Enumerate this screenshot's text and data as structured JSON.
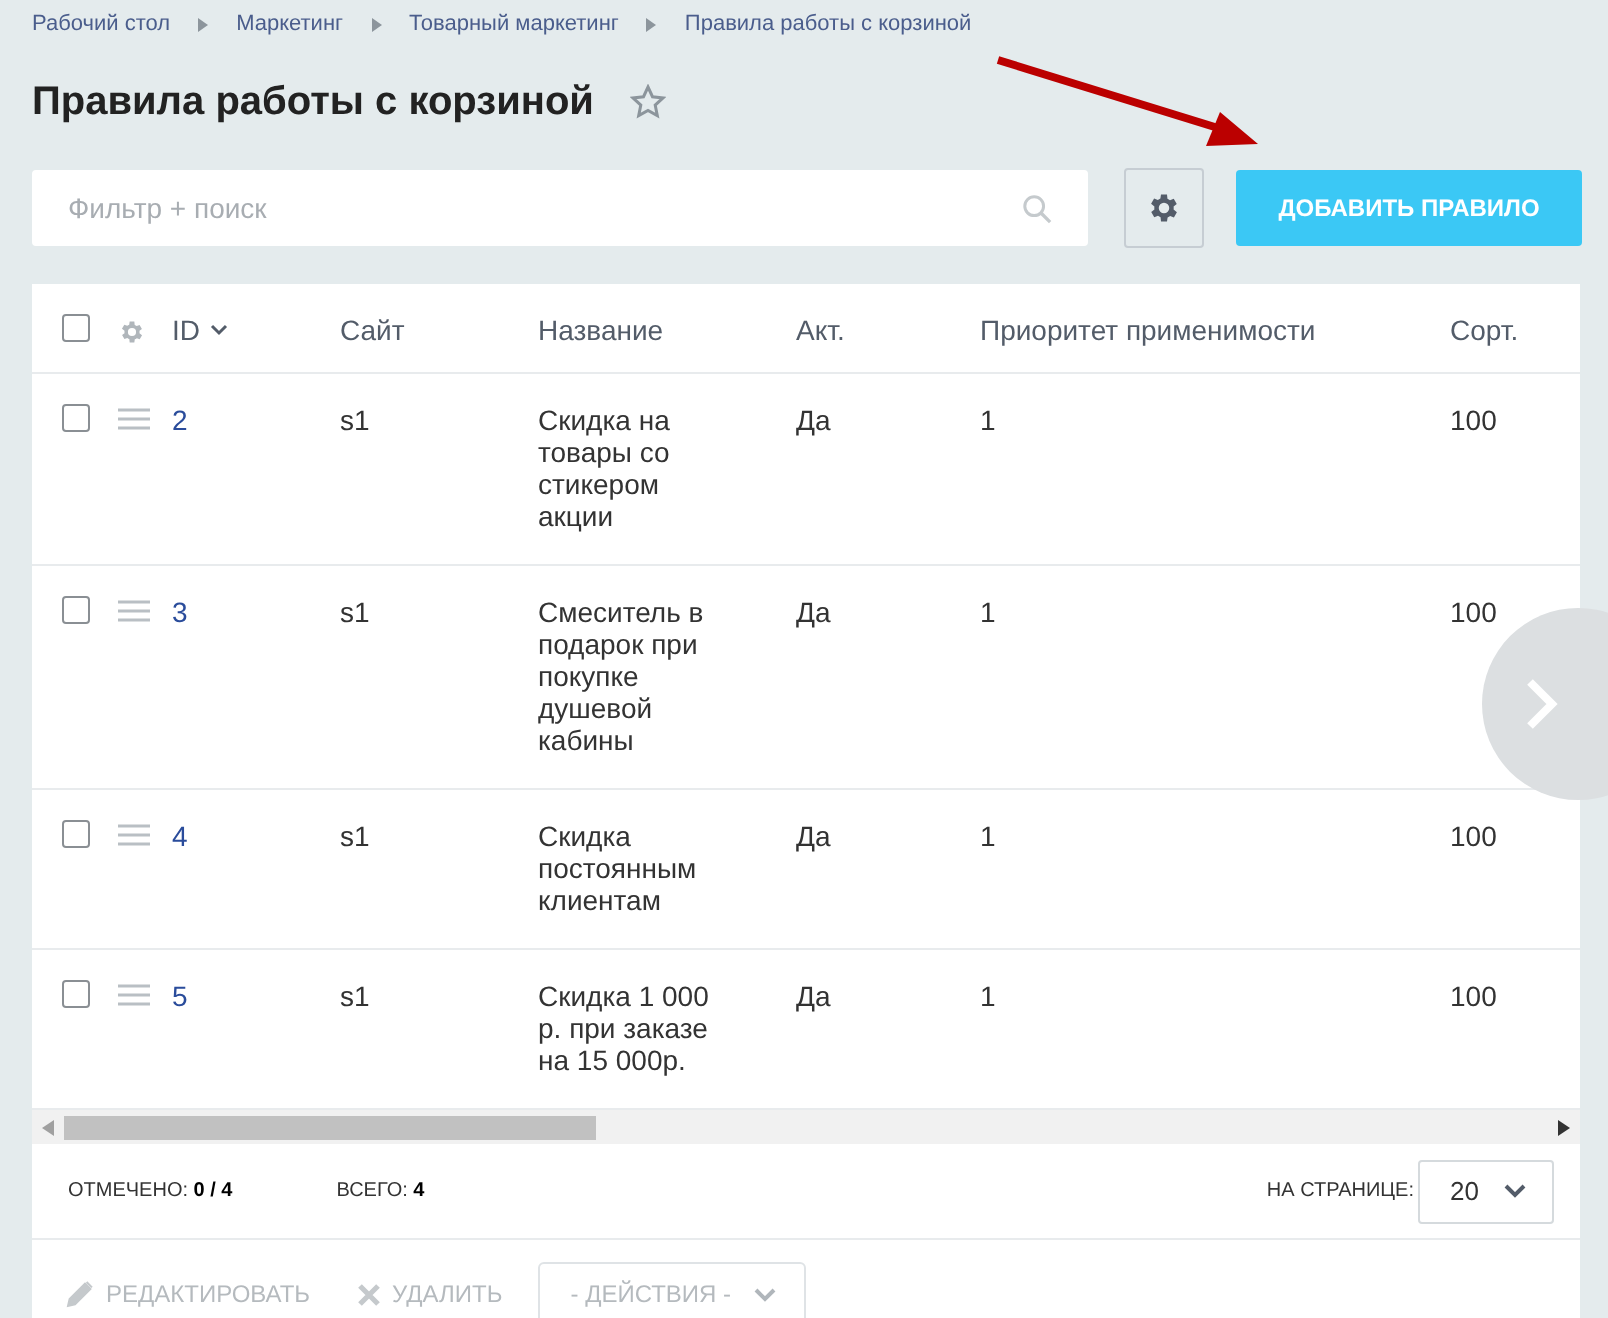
{
  "breadcrumbs": [
    "Рабочий стол",
    "Маркетинг",
    "Товарный маркетинг",
    "Правила работы с корзиной"
  ],
  "title": "Правила работы с корзиной",
  "favorite": false,
  "search": {
    "placeholder": "Фильтр + поиск"
  },
  "add_button": "ДОБАВИТЬ ПРАВИЛО",
  "table": {
    "all_checked": false,
    "columns": [
      "ID",
      "Сайт",
      "Название",
      "Акт.",
      "Приоритет применимости",
      "Сорт."
    ],
    "rows": [
      {
        "checked": false,
        "id": "2",
        "site": "s1",
        "name": "Скидка на товары со стикером акции",
        "active": "Да",
        "priority": "1",
        "sort": "100"
      },
      {
        "checked": false,
        "id": "3",
        "site": "s1",
        "name": "Смеситель в подарок при покупке душевой кабины",
        "active": "Да",
        "priority": "1",
        "sort": "100"
      },
      {
        "checked": false,
        "id": "4",
        "site": "s1",
        "name": "Скидка постоянным клиентам",
        "active": "Да",
        "priority": "1",
        "sort": "100"
      },
      {
        "checked": false,
        "id": "5",
        "site": "s1",
        "name": "Скидка 1 000 р. при заказе на 15 000р.",
        "active": "Да",
        "priority": "1",
        "sort": "100"
      }
    ]
  },
  "footer": {
    "selected_label": "ОТМЕЧЕНО:",
    "selected_value": "0 / 4",
    "total_label": "ВСЕГО:",
    "total_value": "4",
    "per_page_label": "НА СТРАНИЦЕ:",
    "per_page": "20"
  },
  "actions": {
    "edit": "РЕДАКТИРОВАТЬ",
    "delete": "УДАЛИТЬ",
    "menu": "- ДЕЙСТВИЯ -",
    "disabled": true
  }
}
